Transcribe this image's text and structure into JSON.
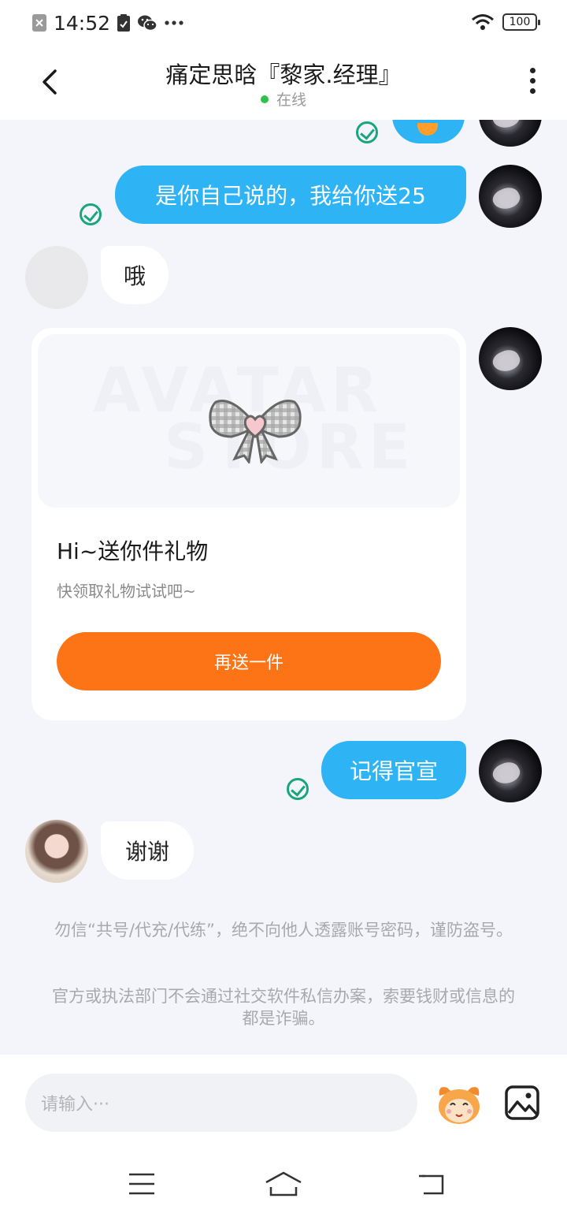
{
  "status_bar": {
    "time": "14:52",
    "battery": "100"
  },
  "header": {
    "title": "痛定思晗『黎家.经理』",
    "status": "在线"
  },
  "messages": {
    "m1": "是你自己说的，我给你送25",
    "m2": "哦",
    "m4": "记得官宣",
    "m5": "谢谢"
  },
  "gift_card": {
    "watermark_line1": "AVATAR",
    "watermark_line2": "STORE",
    "title": "Hi~送你件礼物",
    "subtitle": "快领取礼物试试吧~",
    "button": "再送一件"
  },
  "notices": [
    "勿信“共号/代充/代练”，绝不向他人透露账号密码，谨防盗号。",
    "官方或执法部门不会通过社交软件私信办案，索要钱财或信息的都是诈骗。"
  ],
  "input": {
    "placeholder": "请输入···"
  },
  "colors": {
    "my_bubble": "#2eb4f4",
    "gift_button": "#fc7415",
    "read_check": "#1aa57a",
    "online_dot": "#2ec24a"
  },
  "icons": [
    "back-arrow-icon",
    "more-vertical-icon",
    "read-check-icon",
    "emoji-sticker-icon",
    "image-icon",
    "menu-icon",
    "home-icon",
    "back-nav-icon"
  ]
}
